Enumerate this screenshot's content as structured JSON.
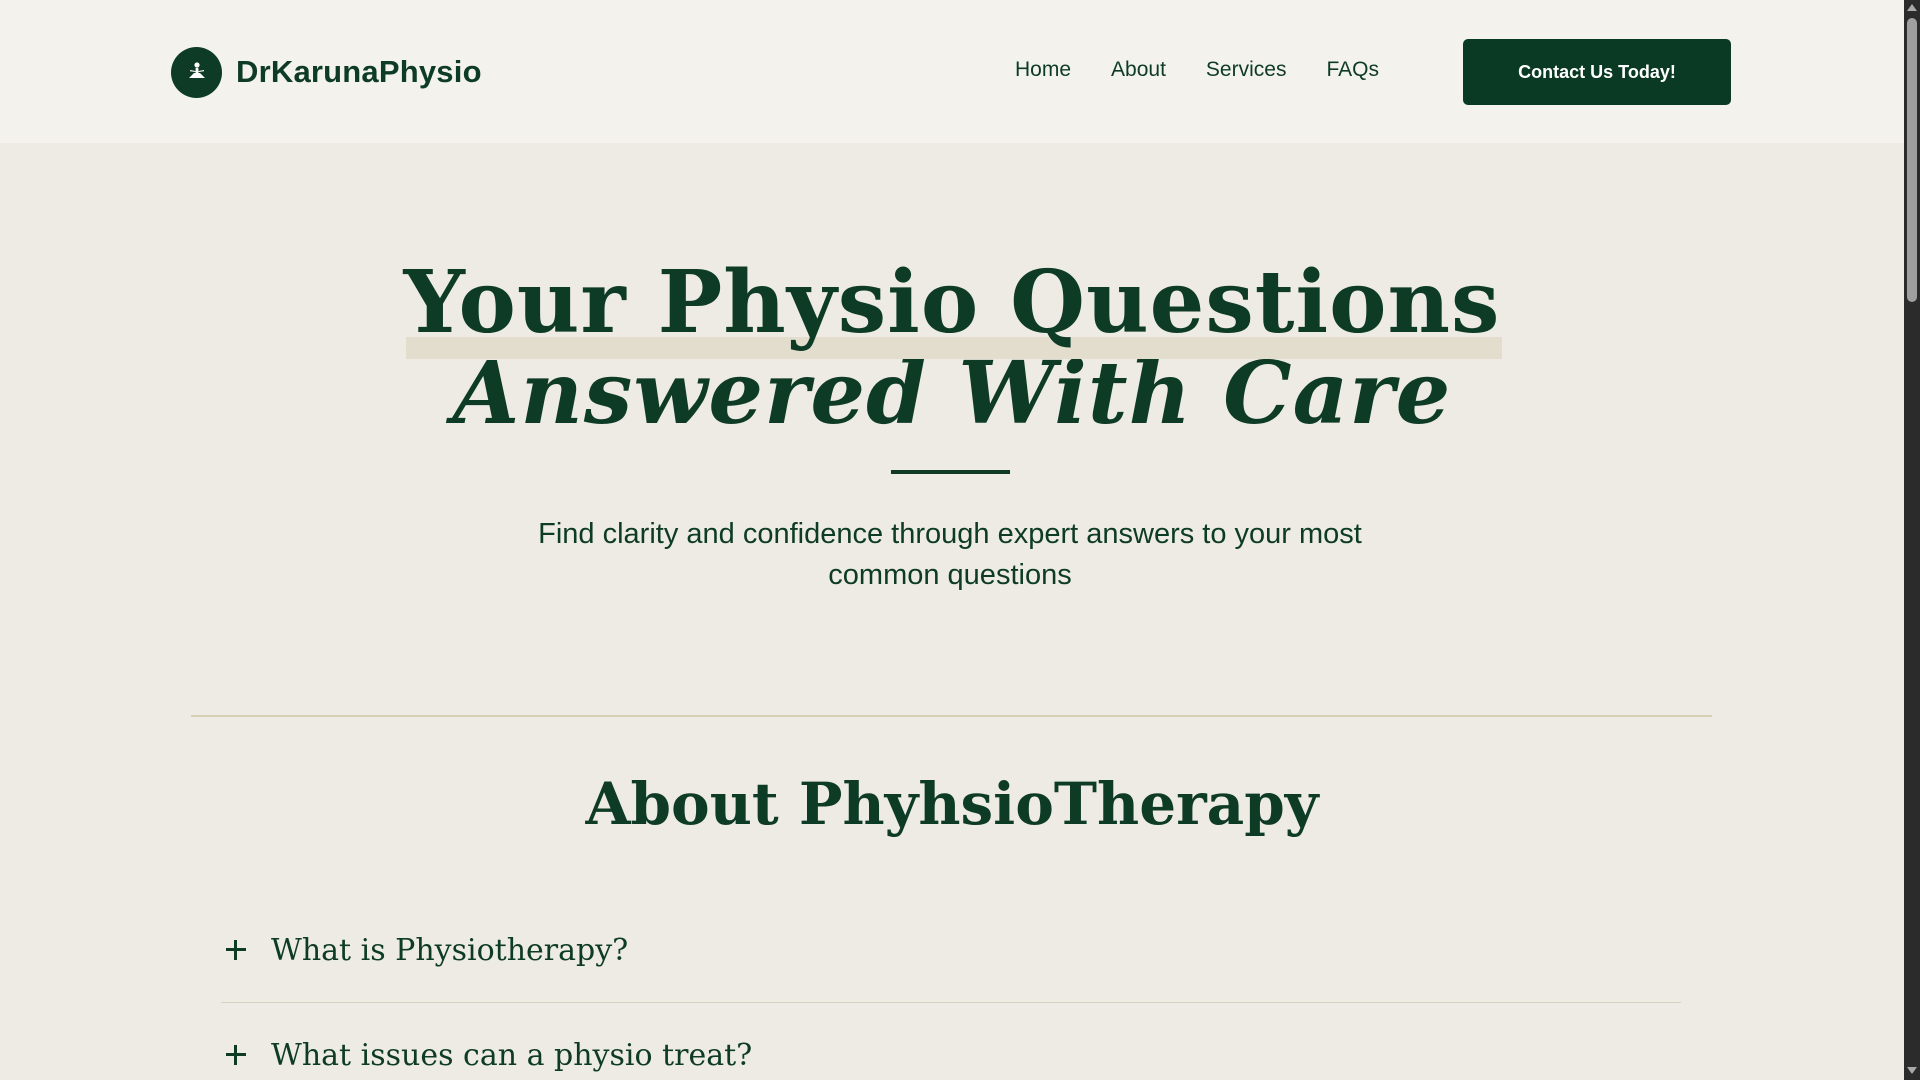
{
  "header": {
    "brand": "DrKarunaPhysio",
    "nav": [
      {
        "label": "Home"
      },
      {
        "label": "About"
      },
      {
        "label": "Services"
      },
      {
        "label": "FAQs"
      }
    ],
    "cta_label": "Contact Us Today!"
  },
  "hero": {
    "title_line1": "Your Physio Questions",
    "title_line2": "Answered With Care",
    "subtitle": "Find clarity and confidence through expert answers to your most common questions"
  },
  "section": {
    "title": "About PhyhsioTherapy",
    "faqs": [
      {
        "question": "What is Physiotherapy?"
      },
      {
        "question": "What issues can a physio treat?"
      }
    ]
  },
  "colors": {
    "brand_green": "#0e3b26",
    "background": "#edebe3",
    "header_bg": "#f3f2ed",
    "highlight": "#e2ddcd",
    "rule_gold": "#d9cfb2"
  },
  "icons": {
    "logo": "person-meditation-icon",
    "faq_toggle": "plus-icon"
  }
}
